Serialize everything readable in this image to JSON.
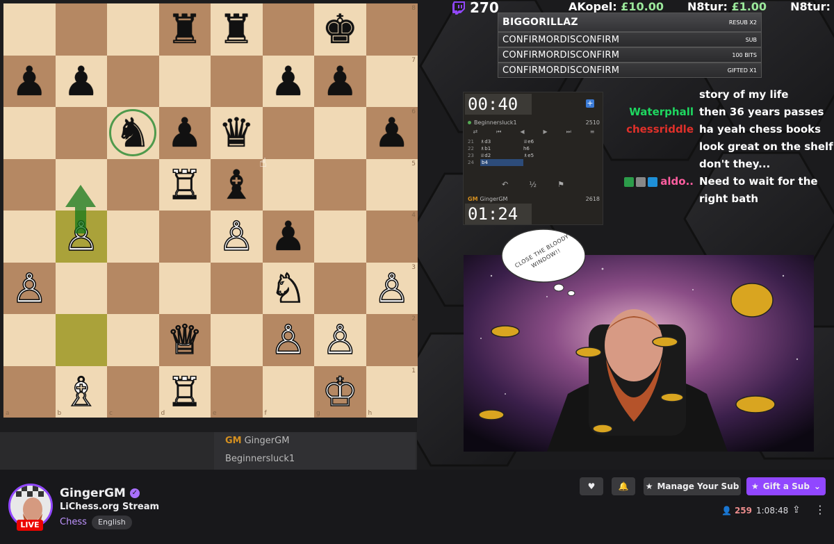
{
  "board": {
    "files": [
      "a",
      "b",
      "c",
      "d",
      "e",
      "f",
      "g",
      "h"
    ],
    "ranks": [
      "8",
      "7",
      "6",
      "5",
      "4",
      "3",
      "2",
      "1"
    ],
    "squares": [
      [
        "",
        "",
        "",
        "♜",
        "♜",
        "",
        "♚",
        ""
      ],
      [
        "♟",
        "♟",
        "",
        "",
        "",
        "♟",
        "♟",
        ""
      ],
      [
        "",
        "",
        "♞",
        "♟",
        "♛",
        "",
        "",
        "♟"
      ],
      [
        "",
        "",
        "",
        "♖",
        "♝",
        "",
        "",
        ""
      ],
      [
        "",
        "♙",
        "",
        "",
        "♙",
        "♟",
        "",
        ""
      ],
      [
        "♙",
        "",
        "",
        "",
        "",
        "♘",
        "",
        "♙"
      ],
      [
        "",
        "",
        "",
        "♕",
        "",
        "♙",
        "♙",
        ""
      ],
      [
        "",
        "♗",
        "",
        "♖",
        "",
        "",
        "♔",
        ""
      ]
    ],
    "highlighted": [
      "b4",
      "b2"
    ],
    "ringed": "c6"
  },
  "under_board": {
    "player1_title": "GM",
    "player1_name": "GingerGM",
    "player2_name": "Beginnersluck1"
  },
  "overlay": {
    "viewer_count": "270",
    "donations": [
      {
        "name": "AKopel:",
        "amount": "£10.00"
      },
      {
        "name": "N8tur:",
        "amount": "£1.00"
      },
      {
        "name": "N8tur:",
        "amount": "£"
      }
    ],
    "events": [
      {
        "name": "BIGGORILLAZ",
        "type": "RESUB X2"
      },
      {
        "name": "CONFIRMORDISCONFIRM",
        "type": "SUB"
      },
      {
        "name": "CONFIRMORDISCONFIRM",
        "type": "100 BITS"
      },
      {
        "name": "CONFIRMORDISCONFIRM",
        "type": "GIFTED X1"
      }
    ]
  },
  "clock_widget": {
    "top_time": "00:40",
    "bottom_time": "01:24",
    "top_player": "Beginnersluck1",
    "top_rating": "2510",
    "bottom_title": "GM",
    "bottom_player": "GingerGM",
    "bottom_rating": "2618",
    "draw_label": "½",
    "moves": [
      {
        "num": "21",
        "white": "♗d3",
        "black": "♕e6"
      },
      {
        "num": "22",
        "white": "♗b1",
        "black": "h6"
      },
      {
        "num": "23",
        "white": "♕d2",
        "black": "♗e5"
      },
      {
        "num": "24",
        "white": "b4",
        "black": ""
      }
    ]
  },
  "chat": [
    {
      "name": "",
      "color": "#ffffff",
      "message": "story of my life"
    },
    {
      "name": "Waterphall",
      "color": "#1ed760",
      "message": "then 36 years passes"
    },
    {
      "name": "chessriddle",
      "color": "#e0302a",
      "message": "ha yeah chess books look great on the shelf don't they..."
    },
    {
      "name": "aldo..",
      "color": "#ff5ea0",
      "message": "Need to wait for the right bath"
    }
  ],
  "webcam": {
    "bubble_text": "CLOSE THE BLOODY WINDOW!!"
  },
  "channel": {
    "name": "GingerGM",
    "title": "LiChess.org Stream",
    "category": "Chess",
    "tag": "English",
    "live_label": "LIVE",
    "viewers": "259",
    "uptime": "1:08:48",
    "manage_sub_label": "Manage Your Sub",
    "gift_sub_label": "Gift a Sub"
  },
  "colors": {
    "twitch_purple": "#9147ff",
    "live_red": "#eb0400",
    "board_light": "#f0d9b5",
    "board_dark": "#b58863"
  }
}
